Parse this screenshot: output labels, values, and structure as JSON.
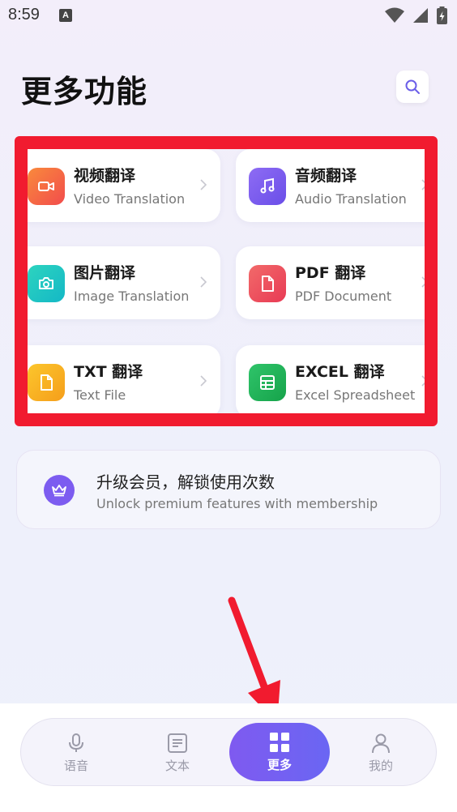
{
  "status": {
    "time": "8:59",
    "badge": "A"
  },
  "header": {
    "title": "更多功能"
  },
  "features": [
    {
      "title": "视频翻译",
      "subtitle": "Video Translation",
      "icon": "video-camera-icon",
      "color": "#f5613c"
    },
    {
      "title": "音频翻译",
      "subtitle": "Audio Translation",
      "icon": "music-note-icon",
      "color": "#7a5cf1"
    },
    {
      "title": "图片翻译",
      "subtitle": "Image Translation",
      "icon": "camera-icon",
      "color": "#1fc4b8"
    },
    {
      "title": "PDF 翻译",
      "subtitle": "PDF Document",
      "icon": "pdf-file-icon",
      "color": "#ef4a5b"
    },
    {
      "title": "TXT 翻译",
      "subtitle": "Text File",
      "icon": "txt-file-icon",
      "color": "#fbb324"
    },
    {
      "title": "EXCEL 翻译",
      "subtitle": "Excel Spreadsheet",
      "icon": "spreadsheet-icon",
      "color": "#1fb45a"
    }
  ],
  "membership": {
    "title": "升级会员，解锁使用次数",
    "subtitle": "Unlock premium features with membership",
    "icon": "crown-icon"
  },
  "nav": [
    {
      "label": "语音",
      "icon": "microphone-icon"
    },
    {
      "label": "文本",
      "icon": "text-document-icon"
    },
    {
      "label": "更多",
      "icon": "grid-icon",
      "active": true
    },
    {
      "label": "我的",
      "icon": "profile-icon"
    }
  ],
  "colors": {
    "accent": "#7b5cf0",
    "annotation": "#f11b2f"
  }
}
